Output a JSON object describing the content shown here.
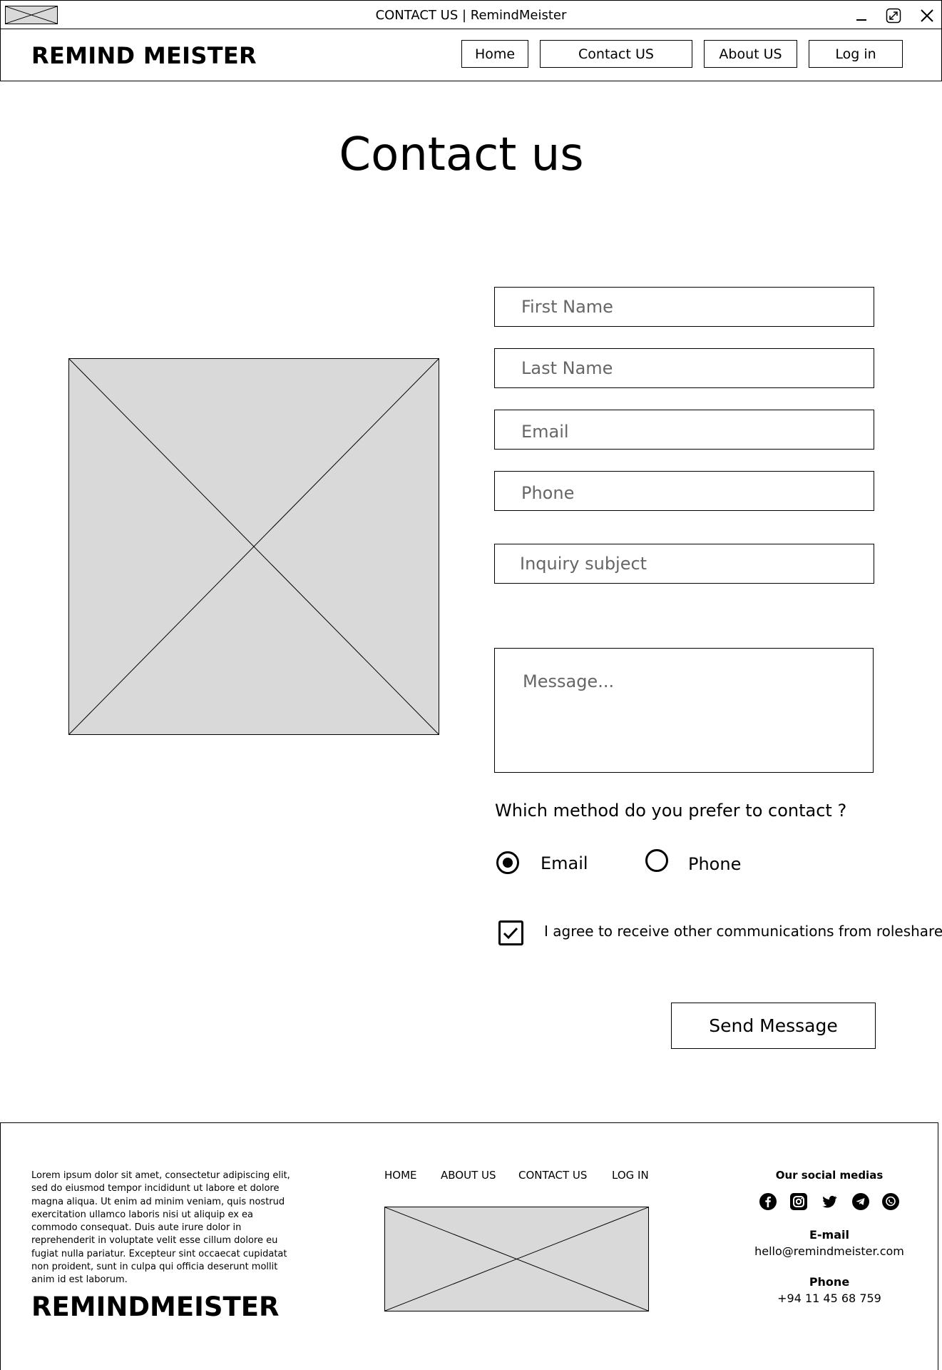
{
  "window": {
    "title": "CONTACT US | RemindMeister"
  },
  "header": {
    "logo": "REMIND MEISTER",
    "nav": {
      "home": "Home",
      "contact": "Contact US",
      "about": "About US",
      "login": "Log in"
    }
  },
  "page": {
    "title": "Contact us"
  },
  "form": {
    "first_name": {
      "placeholder": "First Name",
      "value": ""
    },
    "last_name": {
      "placeholder": "Last Name",
      "value": ""
    },
    "email": {
      "placeholder": "Email",
      "value": ""
    },
    "phone": {
      "placeholder": "Phone",
      "value": ""
    },
    "subject": {
      "placeholder": "Inquiry subject",
      "value": ""
    },
    "message": {
      "placeholder": "Message...",
      "value": ""
    },
    "contact_method": {
      "question": "Which method do you prefer to contact ?",
      "options": [
        {
          "label": "Email",
          "selected": true
        },
        {
          "label": "Phone",
          "selected": false
        }
      ]
    },
    "agree": {
      "label": "I agree to receive other communications from roleshare",
      "checked": true
    },
    "send_label": "Send Message"
  },
  "footer": {
    "lorem": "Lorem ipsum dolor sit amet, consectetur adipiscing elit, sed do eiusmod tempor incididunt ut labore et dolore magna aliqua. Ut enim ad minim veniam, quis nostrud exercitation ullamco laboris nisi ut aliquip ex ea commodo consequat. Duis aute irure dolor in reprehenderit in voluptate velit esse cillum dolore eu fugiat nulla pariatur. Excepteur sint occaecat cupidatat non proident, sunt in culpa qui officia deserunt mollit anim id est laborum.",
    "logo": "REMINDMEISTER",
    "links": {
      "home": "HOME",
      "about": "ABOUT US",
      "contact": "CONTACT US",
      "login": "LOG IN"
    },
    "social_title": "Our social medias",
    "social_icons": [
      "facebook-icon",
      "instagram-icon",
      "twitter-icon",
      "telegram-icon",
      "whatsapp-icon"
    ],
    "email_label": "E-mail",
    "email_value": "hello@remindmeister.com",
    "phone_label": "Phone",
    "phone_value": "+94 11 45 68 759"
  }
}
